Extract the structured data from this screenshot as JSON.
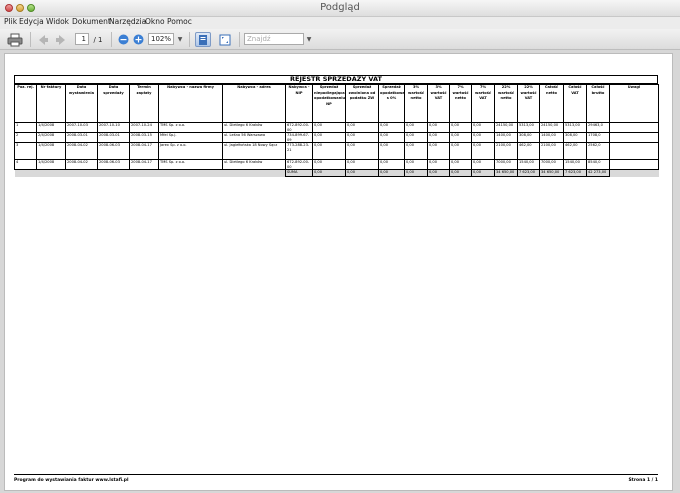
{
  "window": {
    "title": "Podgląd"
  },
  "menu": [
    "Plik",
    "Edycja",
    "Widok",
    "Dokument",
    "Narzędzia",
    "Okno",
    "Pomoc"
  ],
  "toolbar": {
    "page_current": "1",
    "page_total": "/ 1",
    "zoom": "102%",
    "search_placeholder": "Znajdź"
  },
  "report": {
    "title": "REJESTR SPRZEDAŻY VAT",
    "headers": [
      "Poz. rej.",
      "Nr faktury",
      "Data wystawienia",
      "Data sprzedaży",
      "Termin zapłaty",
      "Nabywca - nazwa firmy",
      "Nabywca - adres",
      "Nabywca - NIP",
      "Sprzedaż niepodlegająca opodatkowaniu NP",
      "Sprzedaż zwolniona od podatku ZW",
      "Sprzedaż opodatkowana s 0%",
      "3% wartość netto",
      "3% wartość VAT",
      "7% wartość netto",
      "7% wartość VAT",
      "22% wartość netto",
      "22% wartość VAT",
      "Całość netto",
      "Całość VAT",
      "Całość brutto",
      "Uwagi"
    ],
    "rows": [
      [
        "1",
        "1/4/2008",
        "2007-10-03",
        "2007-10-10",
        "2007-10-24",
        "TMS Sp. z o.o.",
        "ul. Dietlego 6 Kraków",
        "672-892-00-00",
        "0,00",
        "0,00",
        "0,00",
        "0,00",
        "0,00",
        "0,00",
        "0,00",
        "24150,00",
        "5313,00",
        "24150,00",
        "5313,00",
        "29463,0",
        ""
      ],
      [
        "2",
        "2/4/2008",
        "2008-03-01",
        "2008-03-01",
        "2008-03-15",
        "Mfel Sp.j.",
        "ul. Leśna 56 Warszawa",
        "734-899-67-09",
        "0,00",
        "0,00",
        "0,00",
        "0,00",
        "0,00",
        "0,00",
        "0,00",
        "1400,00",
        "308,00",
        "1400,00",
        "308,00",
        "1708,0",
        ""
      ],
      [
        "3",
        "1/4/2008",
        "2008-04-02",
        "2008-06-03",
        "2008-04-17",
        "Jarex Sp. z o.o.",
        "ul. Jagiełłońska 18 Nowy Sącz",
        "773-288-23-21",
        "0,00",
        "0,00",
        "0,00",
        "0,00",
        "0,00",
        "0,00",
        "0,00",
        "2100,00",
        "462,00",
        "2100,00",
        "462,00",
        "2562,0",
        ""
      ],
      [
        "4",
        "1/4/2008",
        "2008-04-02",
        "2008-06-03",
        "2008-04-17",
        "TMS Sp. z o.o.",
        "ul. Dietlego 6 Kraków",
        "672-892-00-00",
        "0,00",
        "0,00",
        "0,00",
        "0,00",
        "0,00",
        "0,00",
        "0,00",
        "7000,00",
        "1540,00",
        "7000,00",
        "1540,00",
        "8540,0",
        ""
      ]
    ],
    "summary": {
      "label": "SUMA",
      "values": [
        "0,00",
        "0,00",
        "0,00",
        "0,00",
        "0,00",
        "0,00",
        "0,00",
        "34 650,00",
        "7 623,00",
        "34 650,00",
        "7 623,00",
        "42 273,00"
      ]
    }
  },
  "footer": {
    "left": "Program do wystawiania faktur www.lstafi.pl",
    "right": "Strona 1 / 1"
  }
}
